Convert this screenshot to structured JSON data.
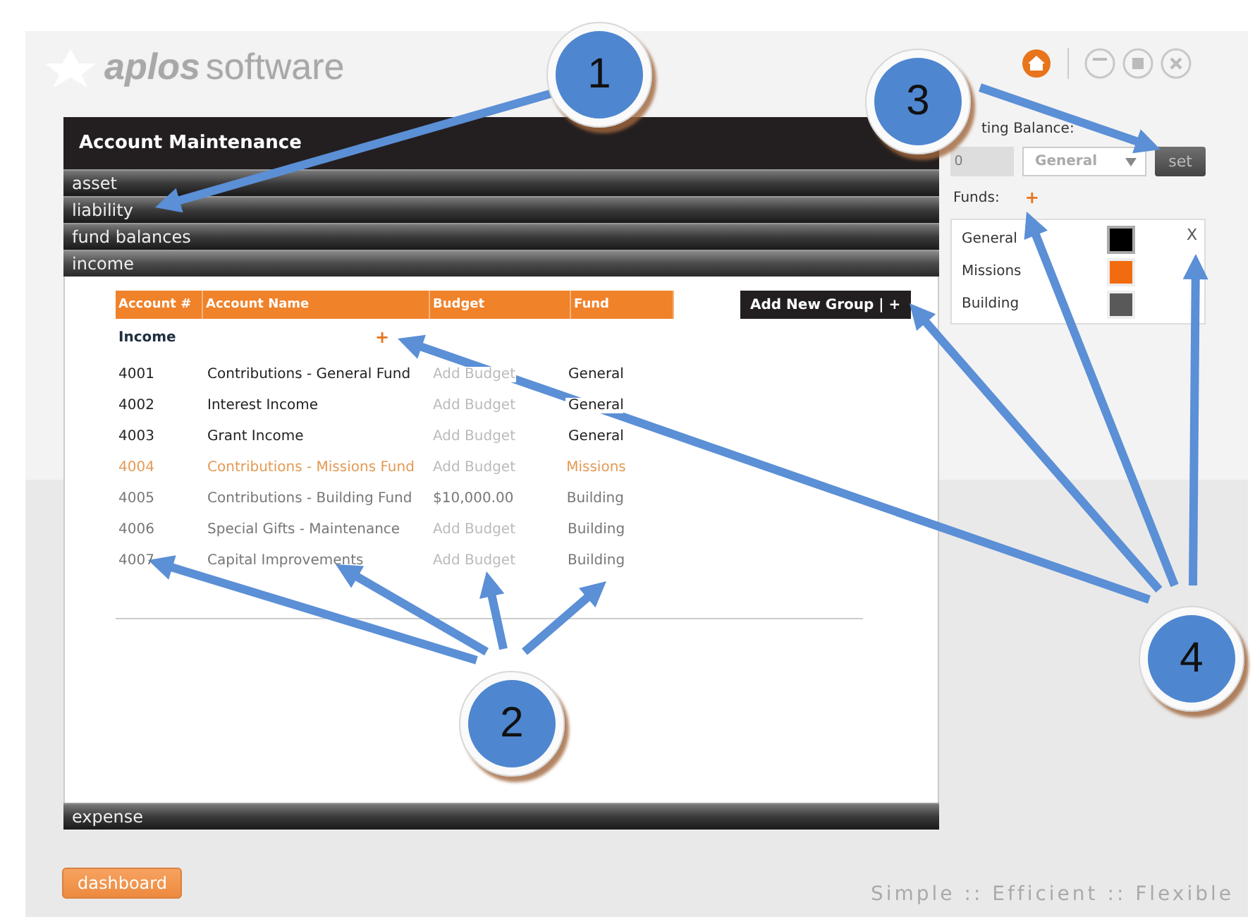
{
  "logo": {
    "bold": "aplos",
    "light": "software"
  },
  "panel": {
    "title": "Account Maintenance",
    "categories": [
      {
        "label": "asset",
        "expanded": false
      },
      {
        "label": "liability",
        "expanded": false
      },
      {
        "label": "fund balances",
        "expanded": false
      },
      {
        "label": "income",
        "expanded": true
      },
      {
        "label": "expense",
        "expanded": false
      }
    ]
  },
  "table": {
    "columns": [
      "Account #",
      "Account Name",
      "Budget",
      "Fund"
    ],
    "group": {
      "label": "Income",
      "add": "+"
    },
    "rows": [
      {
        "kind": "normal",
        "number": "4001",
        "name": "Contributions - General Fund",
        "budget": {
          "placeholder": "Add Budget"
        },
        "fund": "General"
      },
      {
        "kind": "normal",
        "number": "4002",
        "name": "Interest Income",
        "budget": {
          "placeholder": "Add Budget"
        },
        "fund": "General"
      },
      {
        "kind": "normal",
        "number": "4003",
        "name": "Grant Income",
        "budget": {
          "placeholder": "Add Budget"
        },
        "fund": "General"
      },
      {
        "kind": "highlighted",
        "number": "4004",
        "name": "Contributions - Missions Fund",
        "budget": {
          "placeholder": "Add Budget"
        },
        "fund": "Missions"
      },
      {
        "kind": "inactive",
        "number": "4005",
        "name": "Contributions - Building Fund",
        "budget": {
          "value": "$10,000.00"
        },
        "fund": "Building"
      },
      {
        "kind": "inactive",
        "number": "4006",
        "name": "Special Gifts - Maintenance",
        "budget": {
          "placeholder": "Add Budget"
        },
        "fund": "Building"
      },
      {
        "kind": "inactive",
        "number": "4007",
        "name": "Capital Improvements",
        "budget": {
          "placeholder": "Add Budget"
        },
        "fund": "Building"
      }
    ]
  },
  "add_group_button": {
    "label": "Add New Group",
    "separator": "|",
    "plus": "+"
  },
  "starting_balance": {
    "label": "ting Balance:",
    "value": "0",
    "disabled": true,
    "fund": "General",
    "button": "set"
  },
  "funds": {
    "label": "Funds:",
    "add": "+",
    "items": [
      {
        "name": "General",
        "color": "#000000",
        "selected": true,
        "delete": "X"
      },
      {
        "name": "Missions",
        "color": "#f26b0f",
        "selected": false
      },
      {
        "name": "Building",
        "color": "#595959",
        "selected": false
      }
    ]
  },
  "footer": {
    "button": "dashboard",
    "tagline": "Simple :: Efficient :: Flexible"
  },
  "callouts": [
    {
      "number": "1"
    },
    {
      "number": "3"
    },
    {
      "number": "2"
    },
    {
      "number": "4"
    }
  ]
}
